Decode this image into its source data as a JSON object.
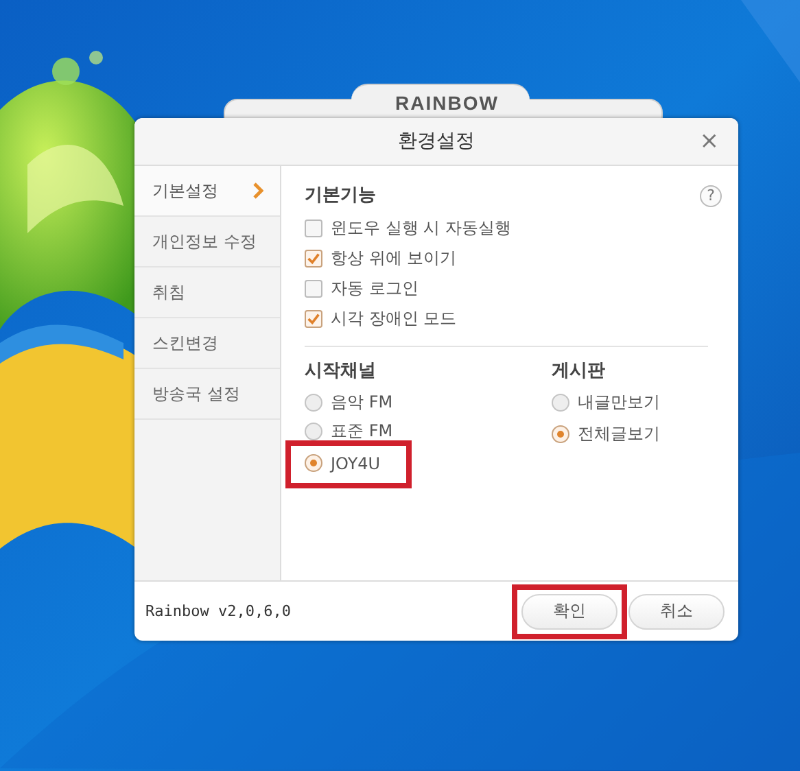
{
  "background_window": {
    "title": "RAINBOW"
  },
  "dialog": {
    "title": "환경설정",
    "close": "×"
  },
  "sidebar": {
    "items": [
      {
        "label": "기본설정",
        "selected": true
      },
      {
        "label": "개인정보 수정",
        "selected": false
      },
      {
        "label": "취침",
        "selected": false
      },
      {
        "label": "스킨변경",
        "selected": false
      },
      {
        "label": "방송국 설정",
        "selected": false
      }
    ]
  },
  "basic": {
    "title": "기본기능",
    "help": "?",
    "options": [
      {
        "label": "윈도우 실행 시 자동실행",
        "checked": false
      },
      {
        "label": "항상 위에 보이기",
        "checked": true
      },
      {
        "label": "자동 로그인",
        "checked": false
      },
      {
        "label": "시각 장애인 모드",
        "checked": true
      }
    ]
  },
  "start_channel": {
    "title": "시작채널",
    "options": [
      {
        "label": "음악 FM",
        "selected": false,
        "highlighted": false
      },
      {
        "label": "표준 FM",
        "selected": false,
        "highlighted": false
      },
      {
        "label": "JOY4U",
        "selected": true,
        "highlighted": true
      }
    ]
  },
  "board": {
    "title": "게시판",
    "options": [
      {
        "label": "내글만보기",
        "selected": false,
        "highlighted": false
      },
      {
        "label": "전체글보기",
        "selected": true,
        "highlighted": false
      }
    ]
  },
  "footer": {
    "version": "Rainbow v2,0,6,0",
    "buttons": [
      {
        "label": "확인",
        "highlighted": true
      },
      {
        "label": "취소",
        "highlighted": false
      }
    ]
  }
}
